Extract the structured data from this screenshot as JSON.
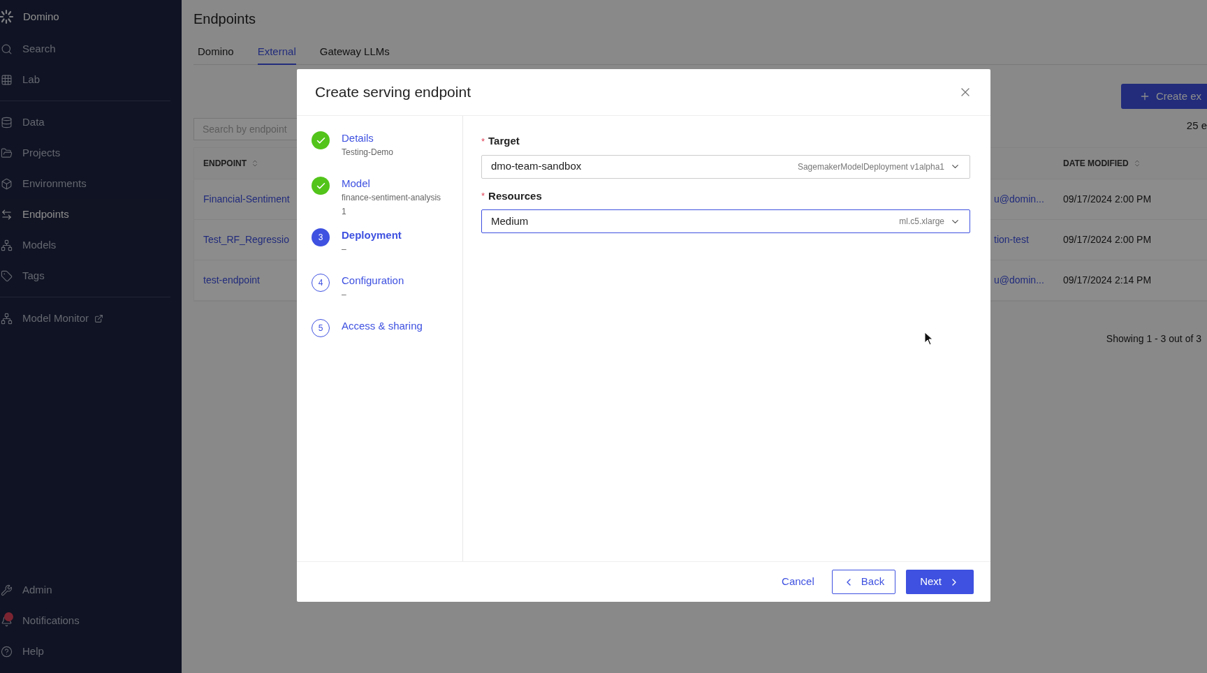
{
  "sidebar": {
    "brand": "Domino",
    "groups": [
      [
        {
          "label": "Search",
          "selected": false,
          "alert": false,
          "external": false
        },
        {
          "label": "Lab",
          "selected": false,
          "alert": false,
          "external": false
        }
      ],
      [
        {
          "label": "Data",
          "selected": false,
          "alert": false,
          "external": false
        },
        {
          "label": "Projects",
          "selected": false,
          "alert": false,
          "external": false
        },
        {
          "label": "Environments",
          "selected": false,
          "alert": false,
          "external": false
        },
        {
          "label": "Endpoints",
          "selected": true,
          "alert": false,
          "external": false
        },
        {
          "label": "Models",
          "selected": false,
          "alert": false,
          "external": false
        },
        {
          "label": "Tags",
          "selected": false,
          "alert": false,
          "external": false
        }
      ],
      [
        {
          "label": "Model Monitor",
          "selected": false,
          "alert": false,
          "external": true
        }
      ]
    ],
    "bottom": [
      {
        "label": "Admin",
        "selected": false,
        "alert": false,
        "external": false
      },
      {
        "label": "Notifications",
        "selected": false,
        "alert": true,
        "external": false
      },
      {
        "label": "Help",
        "selected": false,
        "alert": false,
        "external": false
      }
    ]
  },
  "page": {
    "title": "Endpoints",
    "tabs": [
      {
        "label": "Domino",
        "selected": false
      },
      {
        "label": "External",
        "selected": true
      },
      {
        "label": "Gateway LLMs",
        "selected": false
      }
    ],
    "create_button": "Create ex",
    "count": "25 e",
    "search": {
      "placeholder": "Search by endpoint"
    },
    "table": {
      "columns": [
        "ENDPOINT",
        "DATE MODIFIED"
      ],
      "rows": [
        {
          "endpoint": "Financial-Sentiment",
          "column_3": "u@domin...",
          "date_modified": "09/17/2024 2:00 PM"
        },
        {
          "endpoint": "Test_RF_Regressio",
          "column_3": "tion-test",
          "date_modified": "09/17/2024 2:00 PM"
        },
        {
          "endpoint": "test-endpoint",
          "column_3": "u@domin...",
          "date_modified": "09/17/2024 2:14 PM"
        }
      ]
    },
    "pagination": "Showing 1 - 3 out of 3"
  },
  "dialog": {
    "title": "Create serving endpoint",
    "steps": [
      {
        "label": "Details",
        "completed": true,
        "selected": false,
        "details": [
          "Testing-Demo"
        ]
      },
      {
        "label": "Model",
        "completed": true,
        "selected": false,
        "details": [
          "finance-sentiment-analysis",
          "1"
        ]
      },
      {
        "label": "Deployment",
        "completed": false,
        "selected": true,
        "number": "3",
        "details": [
          "–"
        ]
      },
      {
        "label": "Configuration",
        "completed": false,
        "selected": false,
        "number": "4",
        "details": [
          "–"
        ]
      },
      {
        "label": "Access & sharing",
        "completed": false,
        "selected": false,
        "number": "5"
      }
    ],
    "fields": [
      {
        "label": "Target",
        "required_mark": "*",
        "value": "dmo-team-sandbox",
        "hint": "SagemakerModelDeployment v1alpha1",
        "focused": false
      },
      {
        "label": "Resources",
        "required_mark": "*",
        "value": "Medium",
        "hint": "ml.c5.xlarge",
        "focused": true
      }
    ],
    "buttons": {
      "cancel": "Cancel",
      "back": "Back",
      "next": "Next"
    }
  }
}
